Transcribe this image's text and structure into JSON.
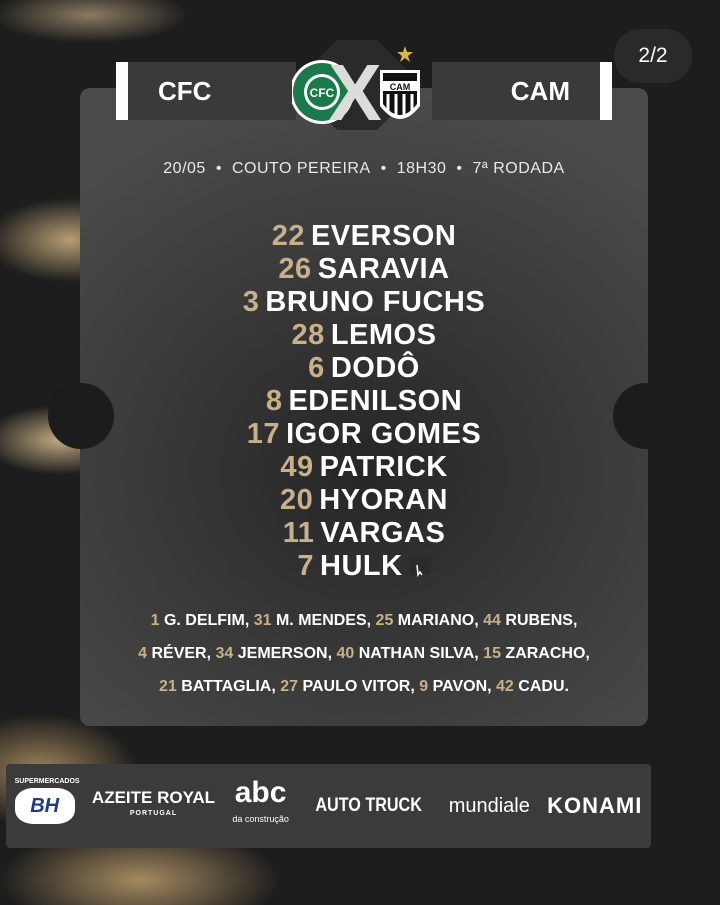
{
  "page_indicator": "2/2",
  "match": {
    "home": "CFC",
    "away": "CAM",
    "versus": "X",
    "date": "20/05",
    "venue": "COUTO PEREIRA",
    "time": "18H30",
    "round": "7ª RODADA"
  },
  "lineup": [
    {
      "number": "22",
      "name": "EVERSON"
    },
    {
      "number": "26",
      "name": "SARAVIA"
    },
    {
      "number": "3",
      "name": "BRUNO FUCHS"
    },
    {
      "number": "28",
      "name": "LEMOS"
    },
    {
      "number": "6",
      "name": "DODÔ"
    },
    {
      "number": "8",
      "name": "EDENILSON"
    },
    {
      "number": "17",
      "name": "IGOR GOMES"
    },
    {
      "number": "49",
      "name": "PATRICK"
    },
    {
      "number": "20",
      "name": "HYORAN"
    },
    {
      "number": "11",
      "name": "VARGAS"
    },
    {
      "number": "7",
      "name": "HULK"
    }
  ],
  "subs": [
    [
      {
        "number": "1",
        "name": "G. DELFIM,"
      },
      {
        "number": "31",
        "name": "M. MENDES,"
      },
      {
        "number": "25",
        "name": "MARIANO,"
      },
      {
        "number": "44",
        "name": "RUBENS,"
      }
    ],
    [
      {
        "number": "4",
        "name": "RÉVER,"
      },
      {
        "number": "34",
        "name": "JEMERSON,"
      },
      {
        "number": "40",
        "name": "NATHAN SILVA,"
      },
      {
        "number": "15",
        "name": "ZARACHO,"
      }
    ],
    [
      {
        "number": "21",
        "name": "BATTAGLIA,"
      },
      {
        "number": "27",
        "name": "PAULO VITOR,"
      },
      {
        "number": "9",
        "name": "PAVON,"
      },
      {
        "number": "42",
        "name": "CADU."
      }
    ]
  ],
  "sponsors": {
    "bh_top": "SUPERMERCADOS",
    "bh": "BH",
    "azeite": "AZEITE ROYAL",
    "azeite_sub": "PORTUGAL",
    "abc": "abc",
    "abc_sub": "da construção",
    "auto": "AUTO TRUCK",
    "mundiale": "mundiale",
    "konami": "KONAMI"
  },
  "colors": {
    "accent_gold": "#c7b08a",
    "coritiba_green": "#1b7a4a",
    "background": "#1c1c1c"
  },
  "icons": {
    "captain": "captain-armband-icon",
    "star": "star-icon"
  }
}
